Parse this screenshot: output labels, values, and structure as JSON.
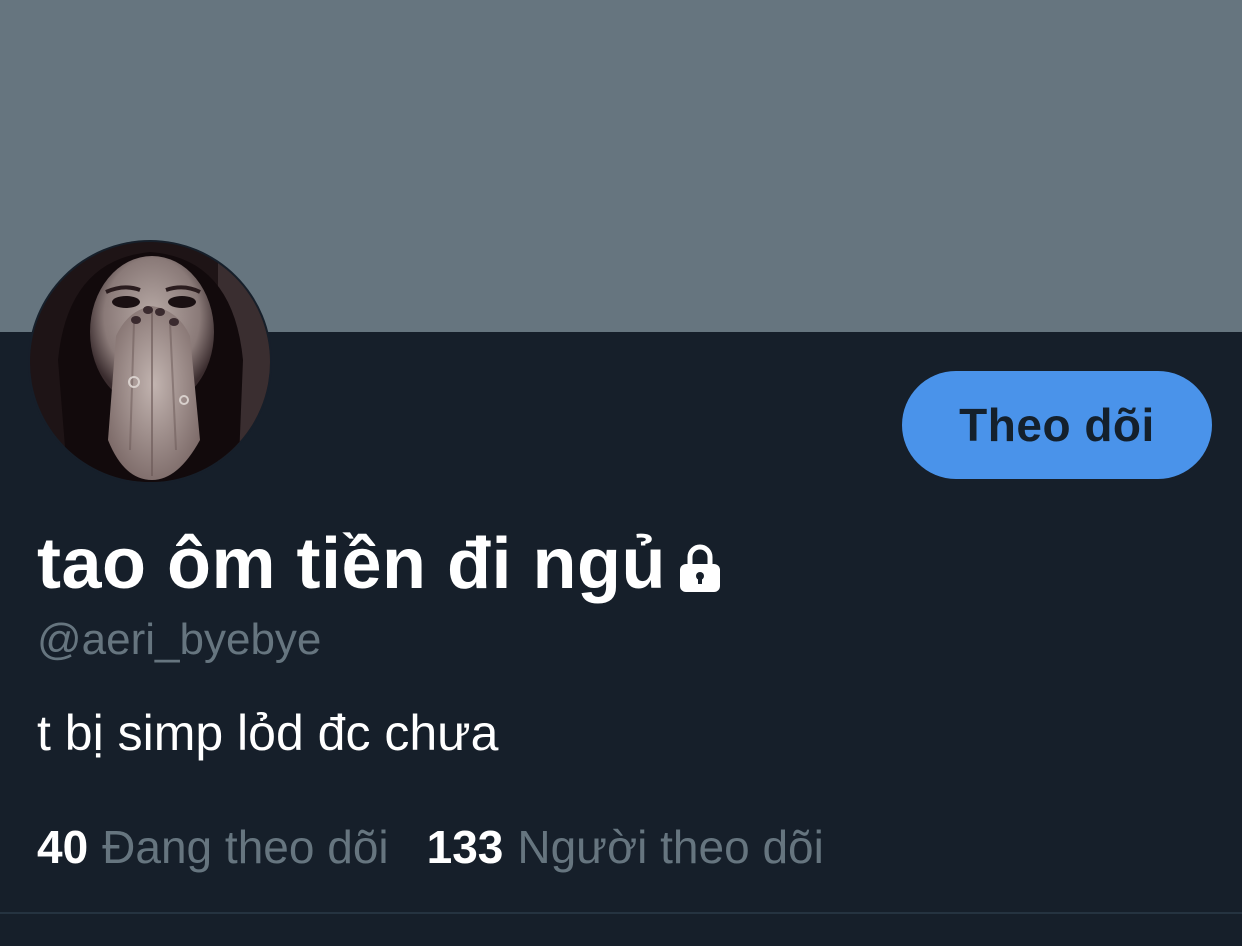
{
  "profile": {
    "display_name": "tao ôm tiền đi ngủ",
    "handle": "@aeri_byebye",
    "bio": "t bị simp lỏd đc chưa",
    "protected_icon": "lock-icon",
    "follow_button_label": "Theo dõi",
    "following_count": "40",
    "following_label": "Đang theo dõi",
    "followers_count": "133",
    "followers_label": "Người theo dõi"
  },
  "colors": {
    "banner": "#66757f",
    "background": "#161f2a",
    "accent": "#4a93ea",
    "secondary_text": "#66757f"
  }
}
